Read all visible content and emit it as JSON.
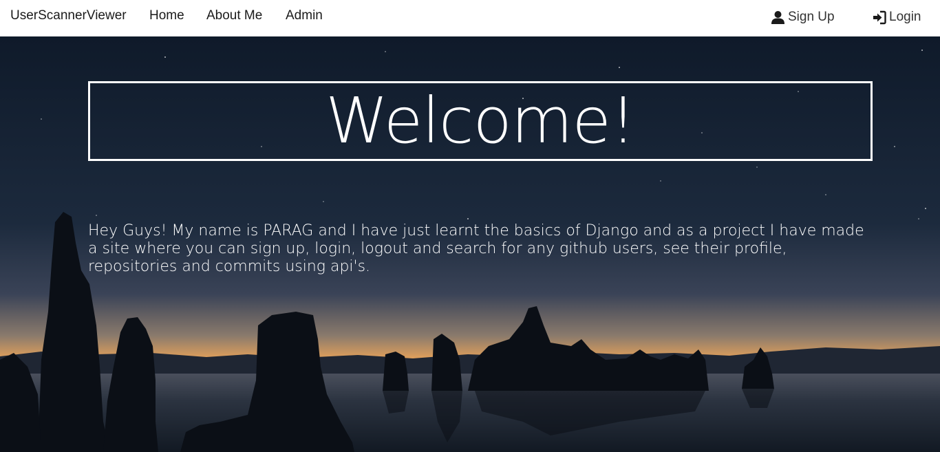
{
  "navbar": {
    "brand": "UserScannerViewer",
    "links": [
      "Home",
      "About Me",
      "Admin"
    ],
    "signup_label": "Sign Up",
    "login_label": "Login"
  },
  "hero": {
    "heading": "Welcome!",
    "intro": "Hey Guys! My name is PARAG and I have just learnt the basics of Django and as a project I have made a site where you can sign up, login, logout and search for any github users, see their profile, repositories and commits using api's."
  },
  "icons": {
    "signup": "user-icon",
    "login": "login-icon"
  },
  "colors": {
    "navbar_bg": "#ffffff",
    "sky_top": "#0f1a2a",
    "horizon_glow": "#e8a35a",
    "text_light": "#ffffff"
  }
}
